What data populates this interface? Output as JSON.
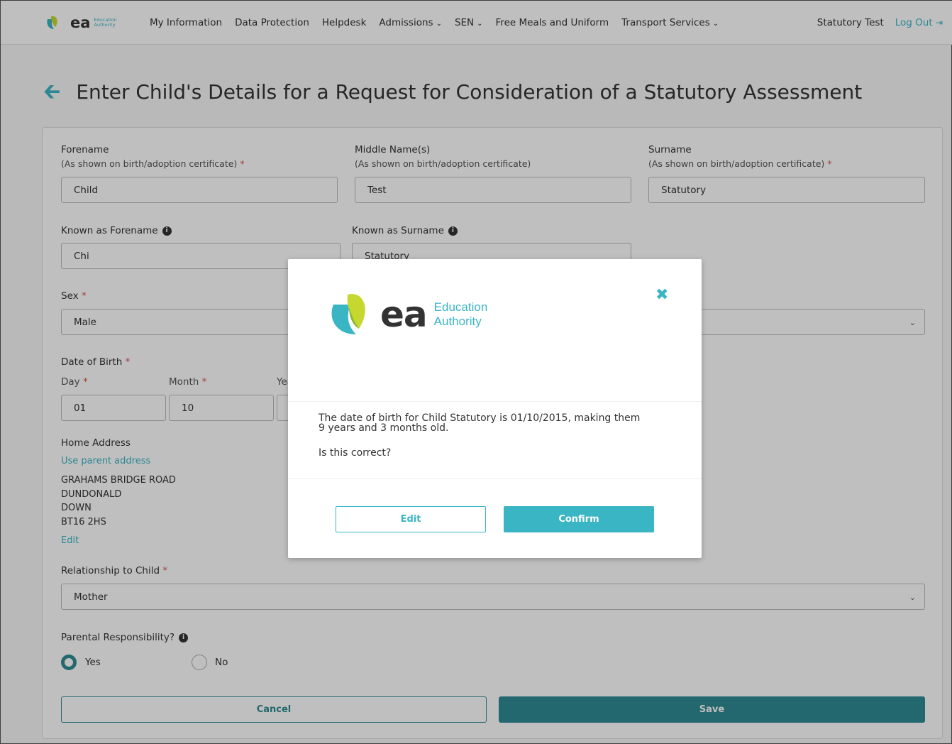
{
  "nav": {
    "logo_text": "ea",
    "logo_sub1": "Education",
    "logo_sub2": "Authority",
    "items": [
      {
        "label": "My Information"
      },
      {
        "label": "Data Protection"
      },
      {
        "label": "Helpdesk"
      },
      {
        "label": "Admissions"
      },
      {
        "label": "SEN"
      },
      {
        "label": "Free Meals and Uniform"
      },
      {
        "label": "Transport Services"
      }
    ],
    "user": "Statutory Test",
    "logout": "Log Out"
  },
  "page": {
    "title": "Enter Child's Details for a Request for Consideration of a Statutory Assessment"
  },
  "form": {
    "forename_label": "Forename",
    "forename_hint": "(As shown on birth/adoption certificate)",
    "forename_value": "Child",
    "middle_label": "Middle Name(s)",
    "middle_hint": "(As shown on birth/adoption certificate)",
    "middle_value": "Test",
    "surname_label": "Surname",
    "surname_hint": "(As shown on birth/adoption certificate)",
    "surname_value": "Statutory",
    "known_forename_label": "Known as Forename",
    "known_forename_value": "Chi",
    "known_surname_label": "Known as Surname",
    "known_surname_value": "Statutory",
    "sex_label": "Sex",
    "sex_value": "Male",
    "dob_label": "Date of Birth",
    "day_label": "Day",
    "day_value": "01",
    "month_label": "Month",
    "month_value": "10",
    "year_label_partial": "Yea",
    "home_address_label": "Home Address",
    "use_parent_address": "Use parent address",
    "address_lines": [
      "GRAHAMS BRIDGE ROAD",
      "DUNDONALD",
      "DOWN",
      "BT16 2HS"
    ],
    "address_edit": "Edit",
    "relationship_label": "Relationship to Child",
    "relationship_value": "Mother",
    "parental_label": "Parental Responsibility?",
    "yes_label": "Yes",
    "no_label": "No",
    "cancel_label": "Cancel",
    "save_label": "Save",
    "required_mark": "*",
    "info_glyph": "i"
  },
  "modal": {
    "logo_text": "ea",
    "logo_sub1": "Education",
    "logo_sub2": "Authority",
    "message_line1": "The date of birth for Child Statutory is 01/10/2015, making them",
    "message_line2": "9 years and 3 months old.",
    "question": "Is this correct?",
    "edit_label": "Edit",
    "confirm_label": "Confirm"
  },
  "colors": {
    "accent": "#3ab5c4",
    "primary": "#2f8b94",
    "required": "#d9534f"
  }
}
